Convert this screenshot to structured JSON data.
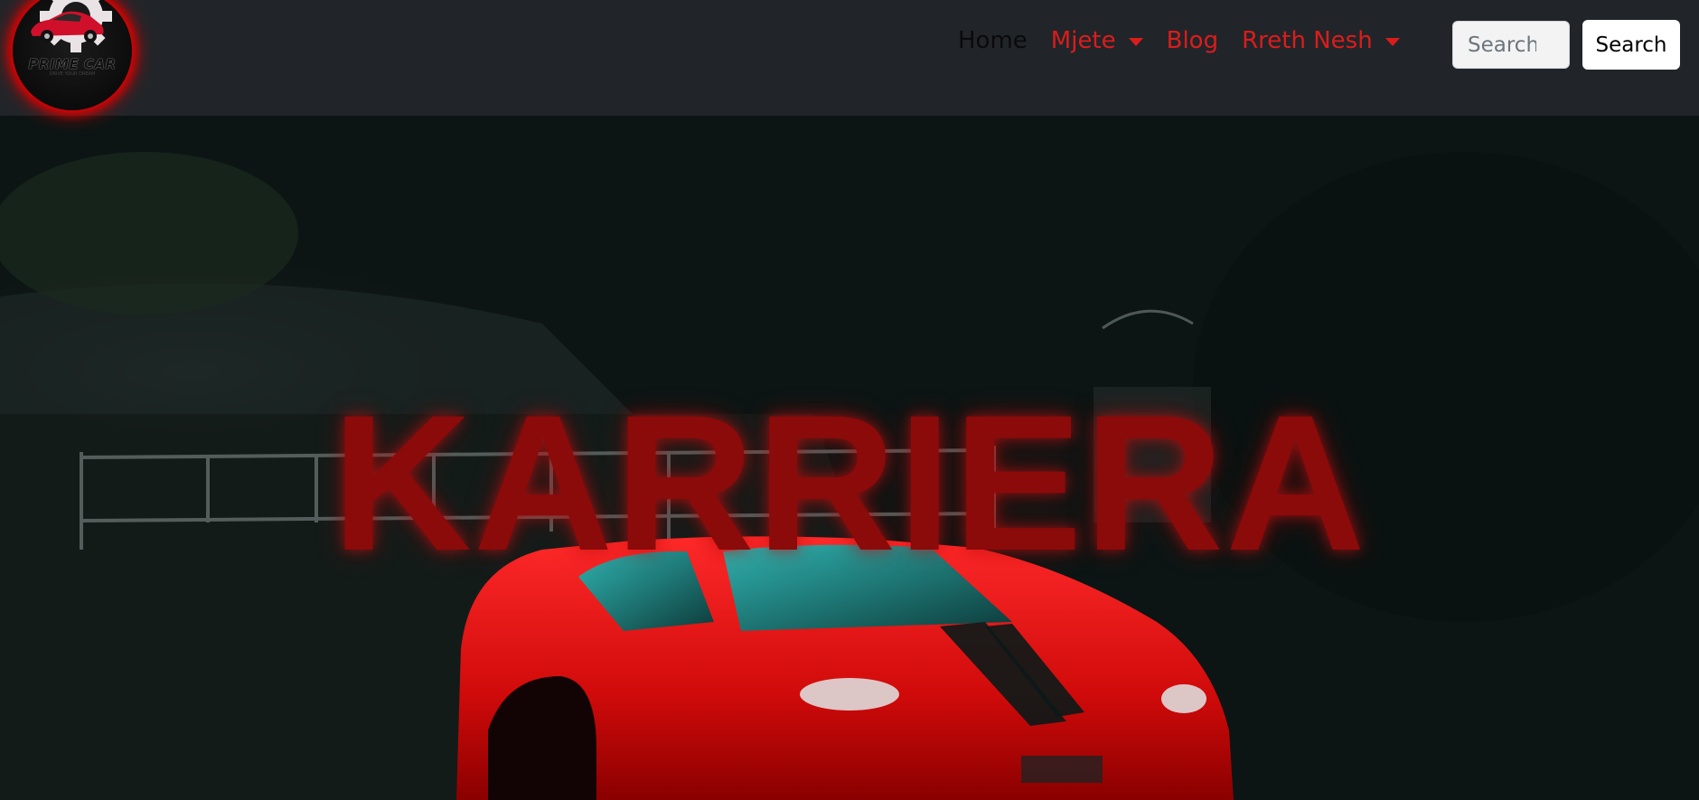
{
  "logo": {
    "text": "PRIME CAR",
    "subtext": "DRIVE YOUR DREAM"
  },
  "nav": {
    "items": [
      {
        "label": "Home",
        "dropdown": false,
        "active": true
      },
      {
        "label": "Mjete",
        "dropdown": true,
        "active": false
      },
      {
        "label": "Blog",
        "dropdown": false,
        "active": false
      },
      {
        "label": "Rreth Nesh",
        "dropdown": true,
        "active": false
      }
    ]
  },
  "search": {
    "placeholder": "Search",
    "button_label": "Search"
  },
  "hero": {
    "title": "KARRIERA",
    "background_image": "red-sports-car-in-dark-forest"
  },
  "colors": {
    "navbar_bg": "#212529",
    "accent_red": "#dc1c1c",
    "title_red": "#8b0a0a"
  }
}
